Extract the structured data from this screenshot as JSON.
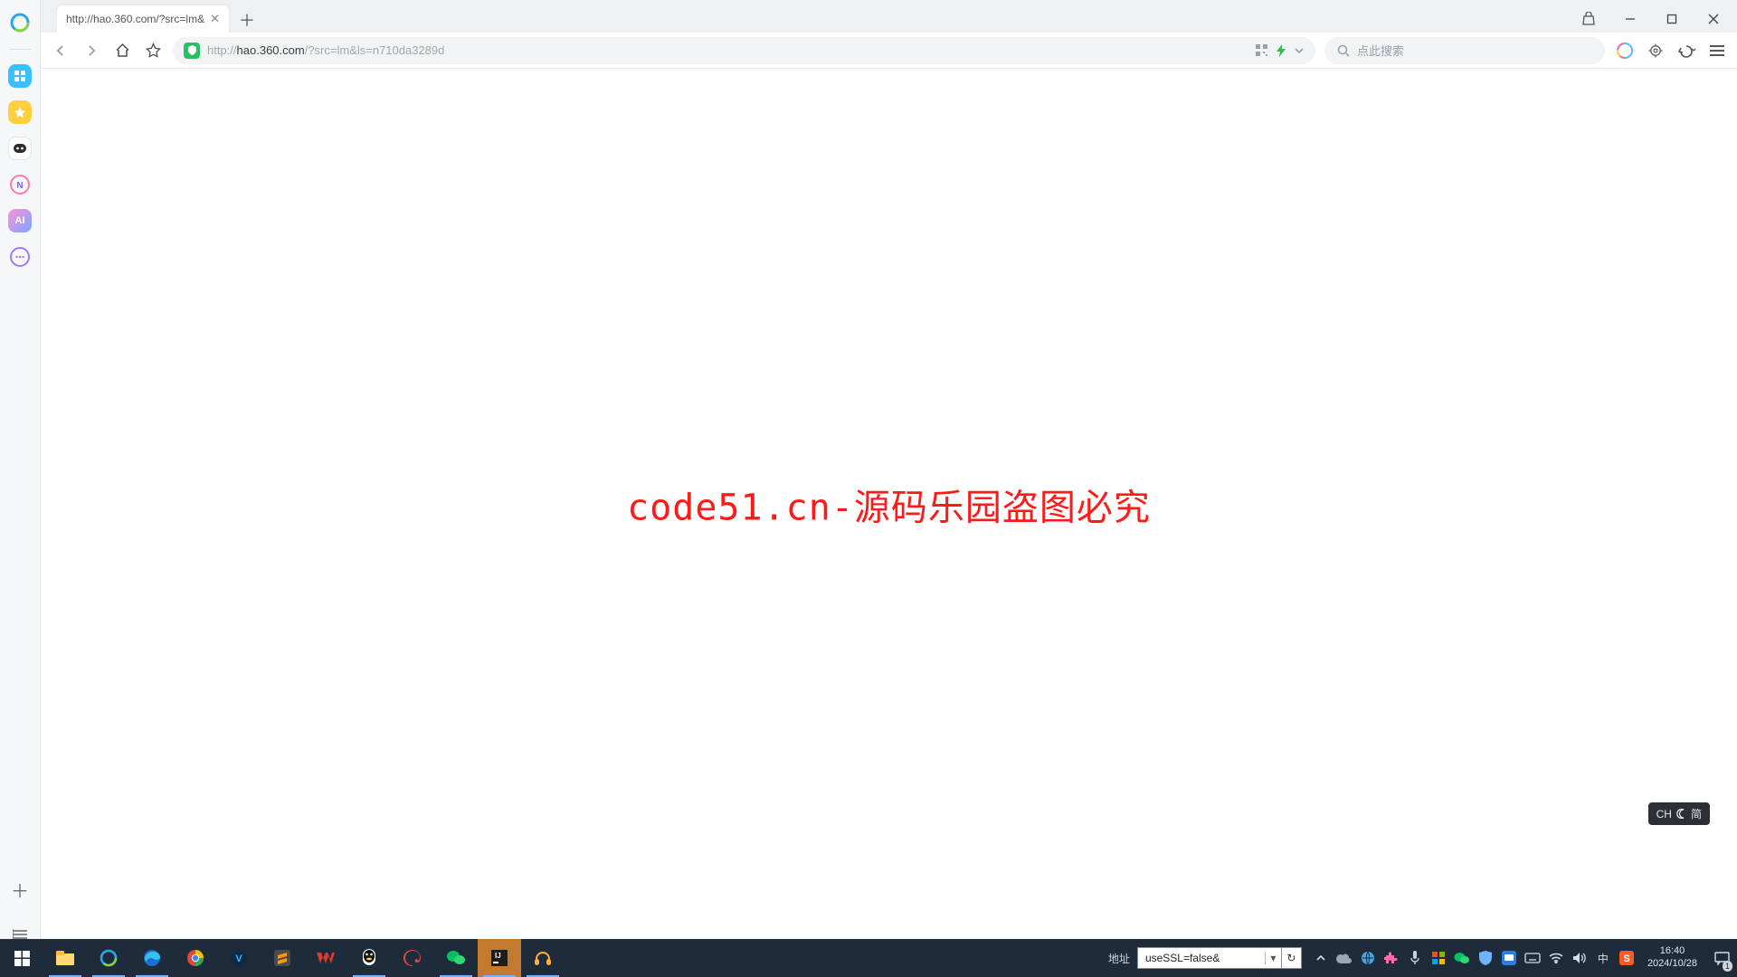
{
  "tab": {
    "title": "http://hao.360.com/?src=lm&"
  },
  "address": {
    "scheme_prefix": "http://",
    "host": "hao.360.com",
    "path": "/?src=lm&ls=n710da3289d"
  },
  "search": {
    "placeholder": "点此搜索"
  },
  "page": {
    "watermark": "code51.cn-源码乐园盗图必究"
  },
  "ime": {
    "lang": "CH",
    "mode": "简"
  },
  "statusbar": {
    "label": "地址",
    "combo_value": "useSSL=false&"
  },
  "clock": {
    "time": "16:40",
    "date": "2024/10/28"
  },
  "notification_badge": "1",
  "colors": {
    "accent_green": "#29c065",
    "watermark_red": "#ff1a1a",
    "taskbar_bg": "#1e2b3a"
  }
}
